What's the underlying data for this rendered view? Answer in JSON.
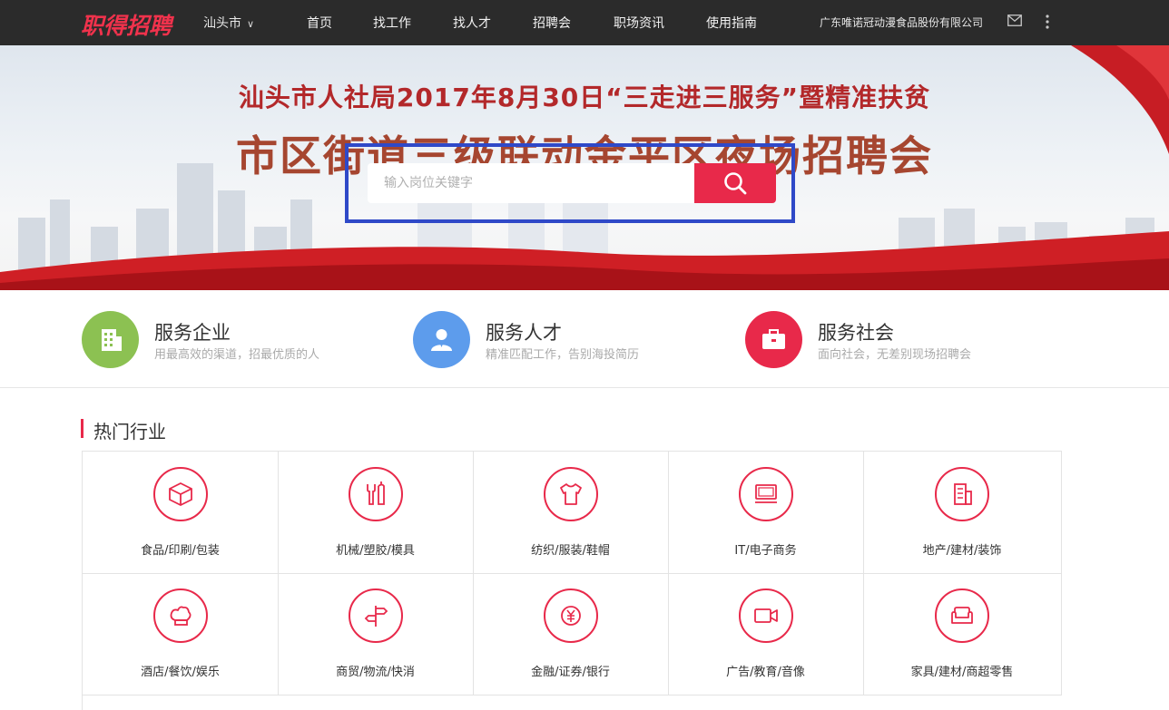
{
  "header": {
    "logo": "职得招聘",
    "city": "汕头市",
    "nav": [
      "首页",
      "找工作",
      "找人才",
      "招聘会",
      "职场资讯",
      "使用指南"
    ],
    "company": "广东唯诺冠动漫食品股份有限公司",
    "icons": [
      "mail-icon",
      "more-vertical-icon"
    ]
  },
  "banner": {
    "line1": "汕头市人社局2017年8月30日“三走进三服务”暨精准扶贫",
    "line2": "市区街道三级联动金平区夜场招聘会",
    "search_placeholder": "输入岗位关键字"
  },
  "services": [
    {
      "title": "服务企业",
      "desc": "用最高效的渠道，招最优质的人",
      "color": "#8cc152",
      "icon": "building-icon"
    },
    {
      "title": "服务人才",
      "desc": "精准匹配工作，告别海投简历",
      "color": "#5d9cec",
      "icon": "person-icon"
    },
    {
      "title": "服务社会",
      "desc": "面向社会，无差别现场招聘会",
      "color": "#e8294a",
      "icon": "briefcase-icon"
    }
  ],
  "hot": {
    "title": "热门行业",
    "items": [
      {
        "label": "食品/印刷/包装",
        "icon": "box-icon"
      },
      {
        "label": "机械/塑胶/模具",
        "icon": "tools-icon"
      },
      {
        "label": "纺织/服装/鞋帽",
        "icon": "shirt-icon"
      },
      {
        "label": "IT/电子商务",
        "icon": "monitor-icon"
      },
      {
        "label": "地产/建材/装饰",
        "icon": "building-icon"
      },
      {
        "label": "酒店/餐饮/娱乐",
        "icon": "chef-hat-icon"
      },
      {
        "label": "商贸/物流/快消",
        "icon": "signpost-icon"
      },
      {
        "label": "金融/证券/银行",
        "icon": "yuan-icon"
      },
      {
        "label": "广告/教育/音像",
        "icon": "video-camera-icon"
      },
      {
        "label": "家具/建材/商超零售",
        "icon": "sofa-icon"
      }
    ]
  },
  "colors": {
    "accent": "#e8294a",
    "topbar": "#2b2b2b",
    "highlight_outline": "#2f49c8"
  }
}
